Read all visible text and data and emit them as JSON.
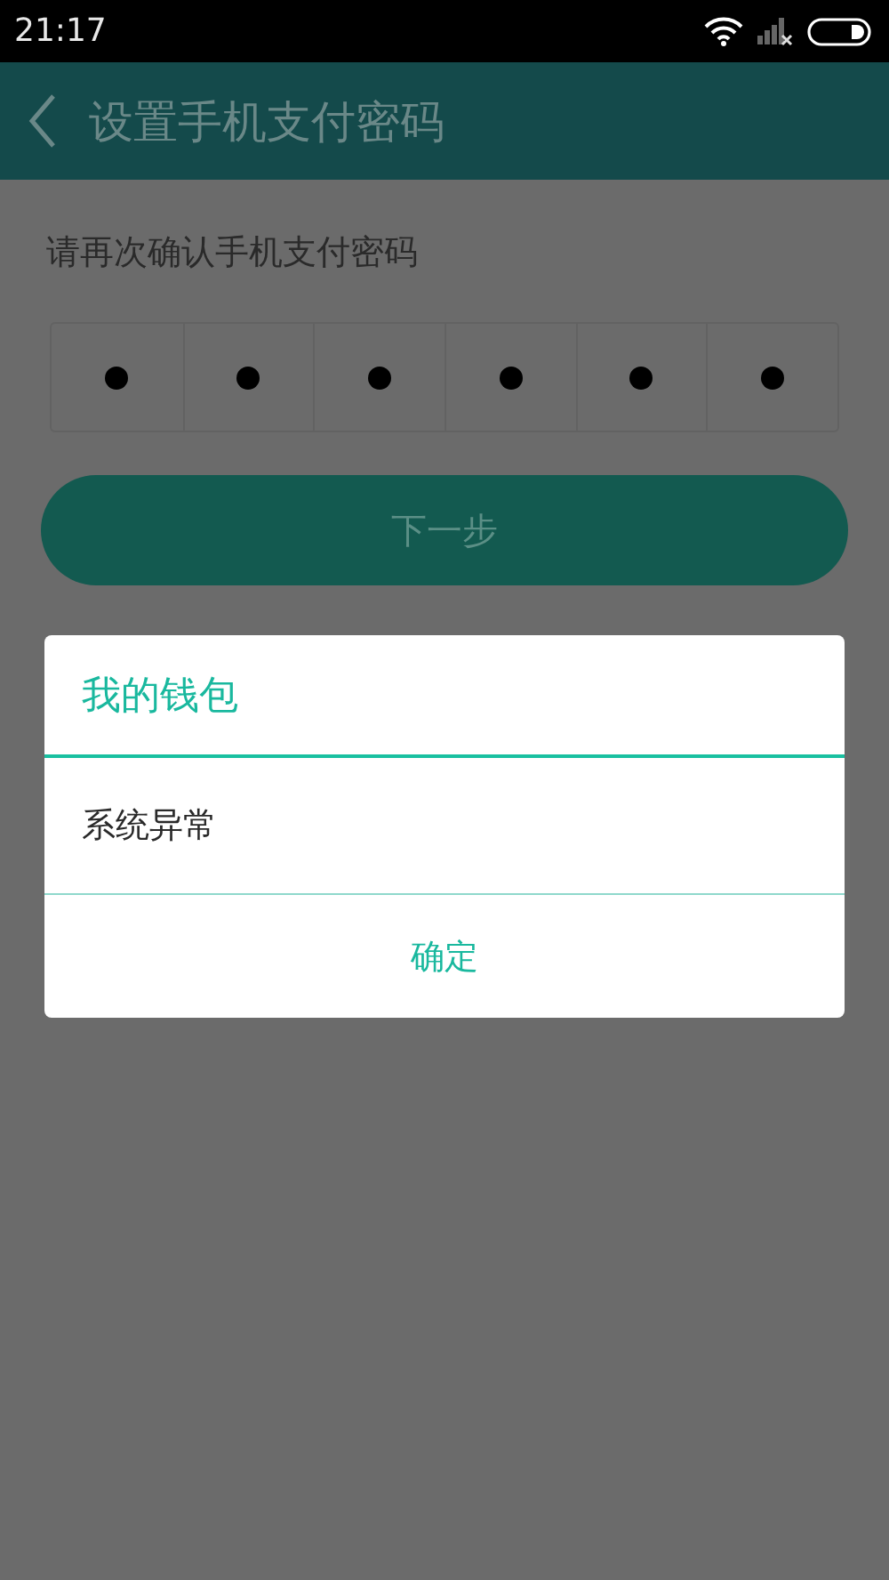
{
  "status_bar": {
    "time": "21:17"
  },
  "header": {
    "title": "设置手机支付密码"
  },
  "prompt": "请再次确认手机支付密码",
  "pin": [
    {
      "filled": true
    },
    {
      "filled": true
    },
    {
      "filled": true
    },
    {
      "filled": true
    },
    {
      "filled": true
    },
    {
      "filled": true
    }
  ],
  "next_button": {
    "label": "下一步"
  },
  "dialog": {
    "title": "我的钱包",
    "message": "系统异常",
    "button": "确定"
  }
}
